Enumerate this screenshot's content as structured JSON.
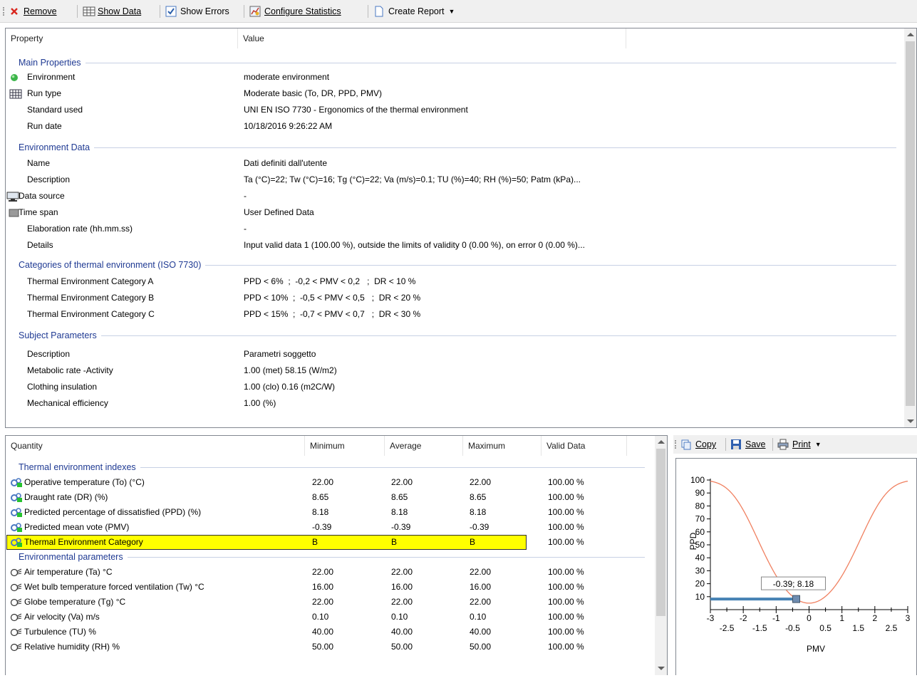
{
  "toolbar": {
    "remove": "Remove",
    "show_data": "Show Data",
    "show_errors": "Show Errors",
    "configure_statistics": "Configure Statistics",
    "create_report": "Create Report"
  },
  "properties": {
    "col_property": "Property",
    "col_value": "Value",
    "groups": {
      "main": "Main Properties",
      "environment": "Environment Data",
      "categories": "Categories of thermal environment (ISO 7730)",
      "subject": "Subject Parameters"
    },
    "rows": [
      {
        "key": "Environment",
        "value": "moderate environment",
        "icon": "green-dot-icon"
      },
      {
        "key": "Run type",
        "value": "Moderate basic (To, DR, PPD, PMV)",
        "icon": "grid-icon"
      },
      {
        "key": "Standard used",
        "value": "UNI EN ISO 7730 - Ergonomics of the thermal environment",
        "icon": ""
      },
      {
        "key": "Run date",
        "value": "10/18/2016 9:26:22 AM",
        "icon": ""
      },
      {
        "key": "Name",
        "value": "Dati definiti dall'utente",
        "icon": ""
      },
      {
        "key": "Description",
        "value": "Ta (°C)=22; Tw (°C)=16; Tg (°C)=22; Va (m/s)=0.1; TU (%)=40; RH (%)=50; Patm (kPa)...",
        "icon": ""
      },
      {
        "key": "Data source",
        "value": "-",
        "icon": "monitor-icon"
      },
      {
        "key": "Time span",
        "value": "User Defined Data",
        "icon": "gray-box-icon"
      },
      {
        "key": "Elaboration rate (hh.mm.ss)",
        "value": "-",
        "icon": ""
      },
      {
        "key": "Details",
        "value": "Input valid data 1 (100.00 %), outside the limits of validity 0 (0.00 %), on error 0 (0.00 %)...",
        "icon": ""
      },
      {
        "key": "Thermal Environment Category A",
        "value": "PPD < 6%  ;  -0,2 < PMV < 0,2   ;  DR < 10 %",
        "icon": ""
      },
      {
        "key": "Thermal Environment Category B",
        "value": "PPD < 10%  ;  -0,5 < PMV < 0,5   ;  DR < 20 %",
        "icon": ""
      },
      {
        "key": "Thermal Environment Category C",
        "value": "PPD < 15%  ;  -0,7 < PMV < 0,7   ;  DR < 30 %",
        "icon": ""
      },
      {
        "key": "Description",
        "value": "Parametri soggetto",
        "icon": ""
      },
      {
        "key": "Metabolic rate -Activity",
        "value": "1.00 (met) 58.15 (W/m2)",
        "icon": ""
      },
      {
        "key": "Clothing insulation",
        "value": "1.00 (clo) 0.16 (m2C/W)",
        "icon": ""
      },
      {
        "key": "Mechanical efficiency",
        "value": "1.00 (%)",
        "icon": ""
      }
    ]
  },
  "quantities": {
    "headers": {
      "quantity": "Quantity",
      "minimum": "Minimum",
      "average": "Average",
      "maximum": "Maximum",
      "valid": "Valid Data"
    },
    "groups": {
      "indexes": "Thermal environment indexes",
      "parameters": "Environmental parameters"
    },
    "rows": [
      {
        "q": "Operative temperature (To) (°C)",
        "min": "22.00",
        "avg": "22.00",
        "max": "22.00",
        "valid": "100.00 %",
        "icon": "gears-icon"
      },
      {
        "q": "Draught rate (DR) (%)",
        "min": "8.65",
        "avg": "8.65",
        "max": "8.65",
        "valid": "100.00 %",
        "icon": "gears-icon"
      },
      {
        "q": "Predicted percentage of dissatisfied (PPD) (%)",
        "min": "8.18",
        "avg": "8.18",
        "max": "8.18",
        "valid": "100.00 %",
        "icon": "gears-icon"
      },
      {
        "q": "Predicted mean vote (PMV)",
        "min": "-0.39",
        "avg": "-0.39",
        "max": "-0.39",
        "valid": "100.00 %",
        "icon": "gears-icon"
      },
      {
        "q": "Thermal Environment Category",
        "min": "B",
        "avg": "B",
        "max": "B",
        "valid": "100.00 %",
        "icon": "gears-icon"
      },
      {
        "q": "Air temperature (Ta) °C",
        "min": "22.00",
        "avg": "22.00",
        "max": "22.00",
        "valid": "100.00 %",
        "icon": "probe-icon"
      },
      {
        "q": "Wet bulb temperature forced ventilation (Tw) °C",
        "min": "16.00",
        "avg": "16.00",
        "max": "16.00",
        "valid": "100.00 %",
        "icon": "probe-icon"
      },
      {
        "q": "Globe temperature (Tg) °C",
        "min": "22.00",
        "avg": "22.00",
        "max": "22.00",
        "valid": "100.00 %",
        "icon": "probe-icon"
      },
      {
        "q": "Air velocity (Va) m/s",
        "min": "0.10",
        "avg": "0.10",
        "max": "0.10",
        "valid": "100.00 %",
        "icon": "probe-icon"
      },
      {
        "q": "Turbulence (TU) %",
        "min": "40.00",
        "avg": "40.00",
        "max": "40.00",
        "valid": "100.00 %",
        "icon": "probe-icon"
      },
      {
        "q": "Relative humidity (RH) %",
        "min": "50.00",
        "avg": "50.00",
        "max": "50.00",
        "valid": "100.00 %",
        "icon": "probe-icon"
      }
    ]
  },
  "chart_toolbar": {
    "copy": "Copy",
    "save": "Save",
    "print": "Print"
  },
  "colors": {
    "curve": "#f08060",
    "marker": "#4682b4",
    "group_title": "#1f3a93",
    "highlight": "#ffff00"
  },
  "chart_data": {
    "type": "line",
    "xlabel": "PMV",
    "ylabel": "PPD",
    "xlim": [
      -3,
      3
    ],
    "ylim": [
      0,
      100
    ],
    "x_ticks_major": [
      -3,
      -2,
      -1,
      0,
      1,
      2,
      3
    ],
    "x_ticks_minor": [
      -2.5,
      -1.5,
      -0.5,
      0.5,
      1.5,
      2.5
    ],
    "y_ticks": [
      10,
      20,
      30,
      40,
      50,
      60,
      70,
      80,
      90,
      100
    ],
    "series": [
      {
        "formula": "PPD = 100 - 95*exp(-0.03353*PMV^4 - 0.2179*PMV^2)",
        "x": [
          -3,
          -2.5,
          -2,
          -1.5,
          -1,
          -0.5,
          0,
          0.5,
          1,
          1.5,
          2,
          2.5,
          3
        ],
        "y": [
          99.1,
          93.2,
          76.8,
          51.0,
          26.1,
          10.2,
          5.0,
          10.2,
          26.1,
          51.0,
          76.8,
          93.2,
          99.1
        ]
      }
    ],
    "point": {
      "x": -0.39,
      "y": 8.18,
      "label": "-0.39; 8.18"
    }
  }
}
